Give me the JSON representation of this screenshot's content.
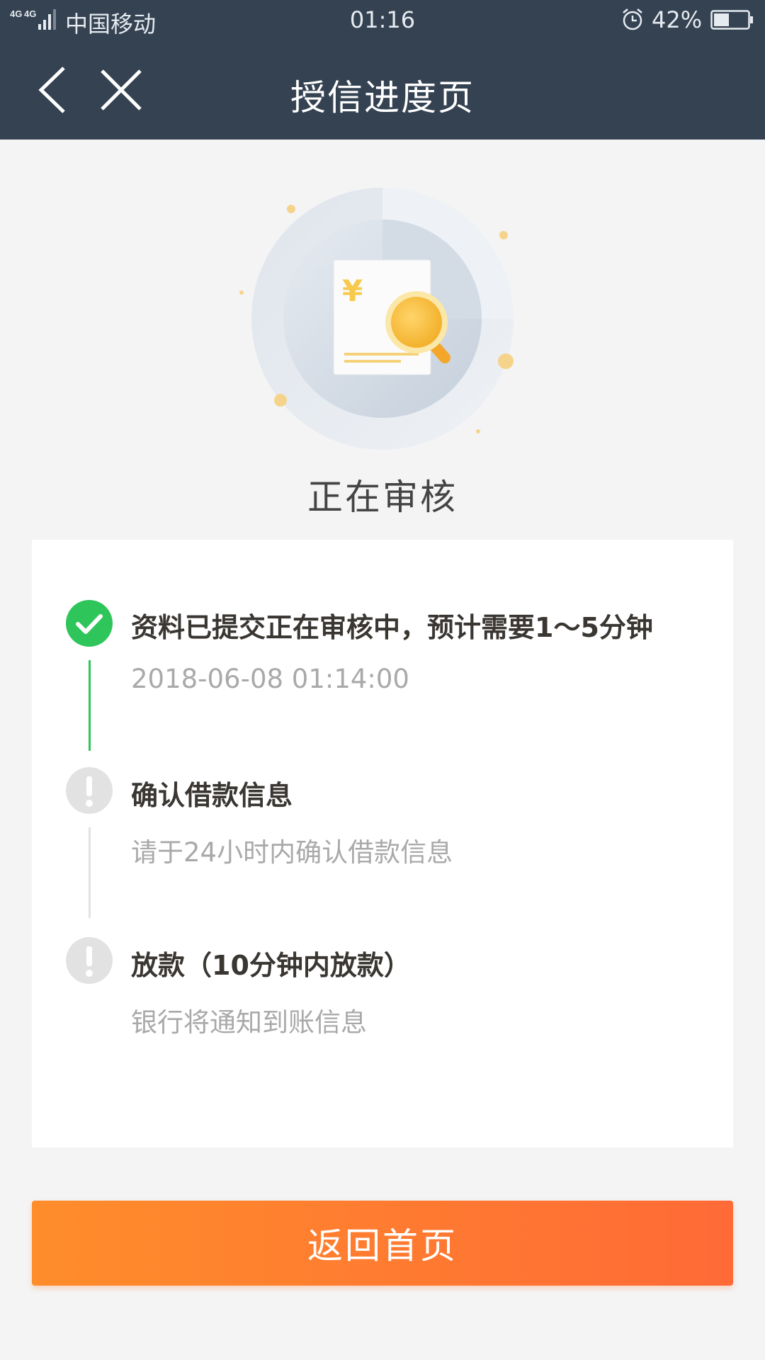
{
  "status_bar": {
    "network": "4G 4G",
    "carrier": "中国移动",
    "time": "01:16",
    "battery_percent": "42%"
  },
  "nav": {
    "title": "授信进度页",
    "back_icon": "chevron-left-icon",
    "close_icon": "close-icon"
  },
  "illustration": {
    "currency_symbol": "¥"
  },
  "status_title": "正在审核",
  "steps": [
    {
      "state": "done",
      "icon": "check-circle-icon",
      "title": "资料已提交正在审核中，预计需要1～5分钟",
      "subtitle": "2018-06-08 01:14:00"
    },
    {
      "state": "pending",
      "icon": "exclamation-circle-icon",
      "title": "确认借款信息",
      "subtitle": "请于24小时内确认借款信息"
    },
    {
      "state": "pending",
      "icon": "exclamation-circle-icon",
      "title": "放款（10分钟内放款）",
      "subtitle": "银行将通知到账信息"
    }
  ],
  "home_button_label": "返回首页",
  "colors": {
    "header_bg": "#344252",
    "page_bg": "#f4f4f4",
    "done_green": "#2ec55a",
    "pending_gray": "#e2e2e2",
    "button_orange_start": "#ff8d2b",
    "button_orange_end": "#ff6a36"
  }
}
